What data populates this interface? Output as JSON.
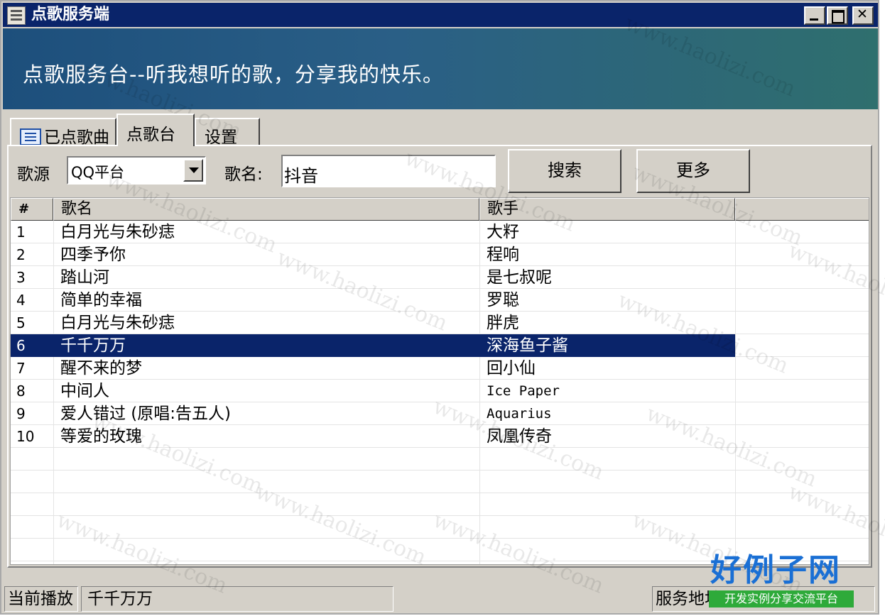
{
  "window": {
    "title": "点歌服务端"
  },
  "banner": {
    "text": "点歌服务台--听我想听的歌，分享我的快乐。"
  },
  "tabs": [
    {
      "label": "已点歌曲",
      "icon": "list-icon"
    },
    {
      "label": "点歌台",
      "selected": true
    },
    {
      "label": "设置"
    }
  ],
  "search": {
    "source_label": "歌源",
    "source_value": "QQ平台",
    "song_label": "歌名:",
    "song_value": "抖音",
    "search_button": "搜索",
    "more_button": "更多"
  },
  "table": {
    "columns": [
      "#",
      "歌名",
      "歌手",
      ""
    ],
    "rows": [
      {
        "num": "1",
        "song": "白月光与朱砂痣",
        "singer": "大籽"
      },
      {
        "num": "2",
        "song": "四季予你",
        "singer": "程响"
      },
      {
        "num": "3",
        "song": "踏山河",
        "singer": "是七叔呢"
      },
      {
        "num": "4",
        "song": "简单的幸福",
        "singer": "罗聪"
      },
      {
        "num": "5",
        "song": "白月光与朱砂痣",
        "singer": "胖虎"
      },
      {
        "num": "6",
        "song": "千千万万",
        "singer": "深海鱼子酱",
        "selected": true
      },
      {
        "num": "7",
        "song": "醒不来的梦",
        "singer": "回小仙"
      },
      {
        "num": "8",
        "song": "中间人",
        "singer": "Ice Paper"
      },
      {
        "num": "9",
        "song": "爱人错过 (原唱:告五人)",
        "singer": "Aquarius"
      },
      {
        "num": "10",
        "song": "等爱的玫瑰",
        "singer": "凤凰传奇"
      }
    ]
  },
  "status": {
    "now_playing_label": "当前播放",
    "now_playing_value": "千千万万",
    "server_address_label": "服务地址"
  },
  "watermark": {
    "text": "www.haolizi.com"
  },
  "logo": {
    "main": "好例子网",
    "sub": "开发实例分享交流平台"
  },
  "colors": {
    "titlebar": "#0a246a",
    "selection": "#0a246a",
    "banner": "#1d4f7c",
    "logo_blue": "#1a6fd4",
    "logo_green": "#2eaa3a"
  }
}
